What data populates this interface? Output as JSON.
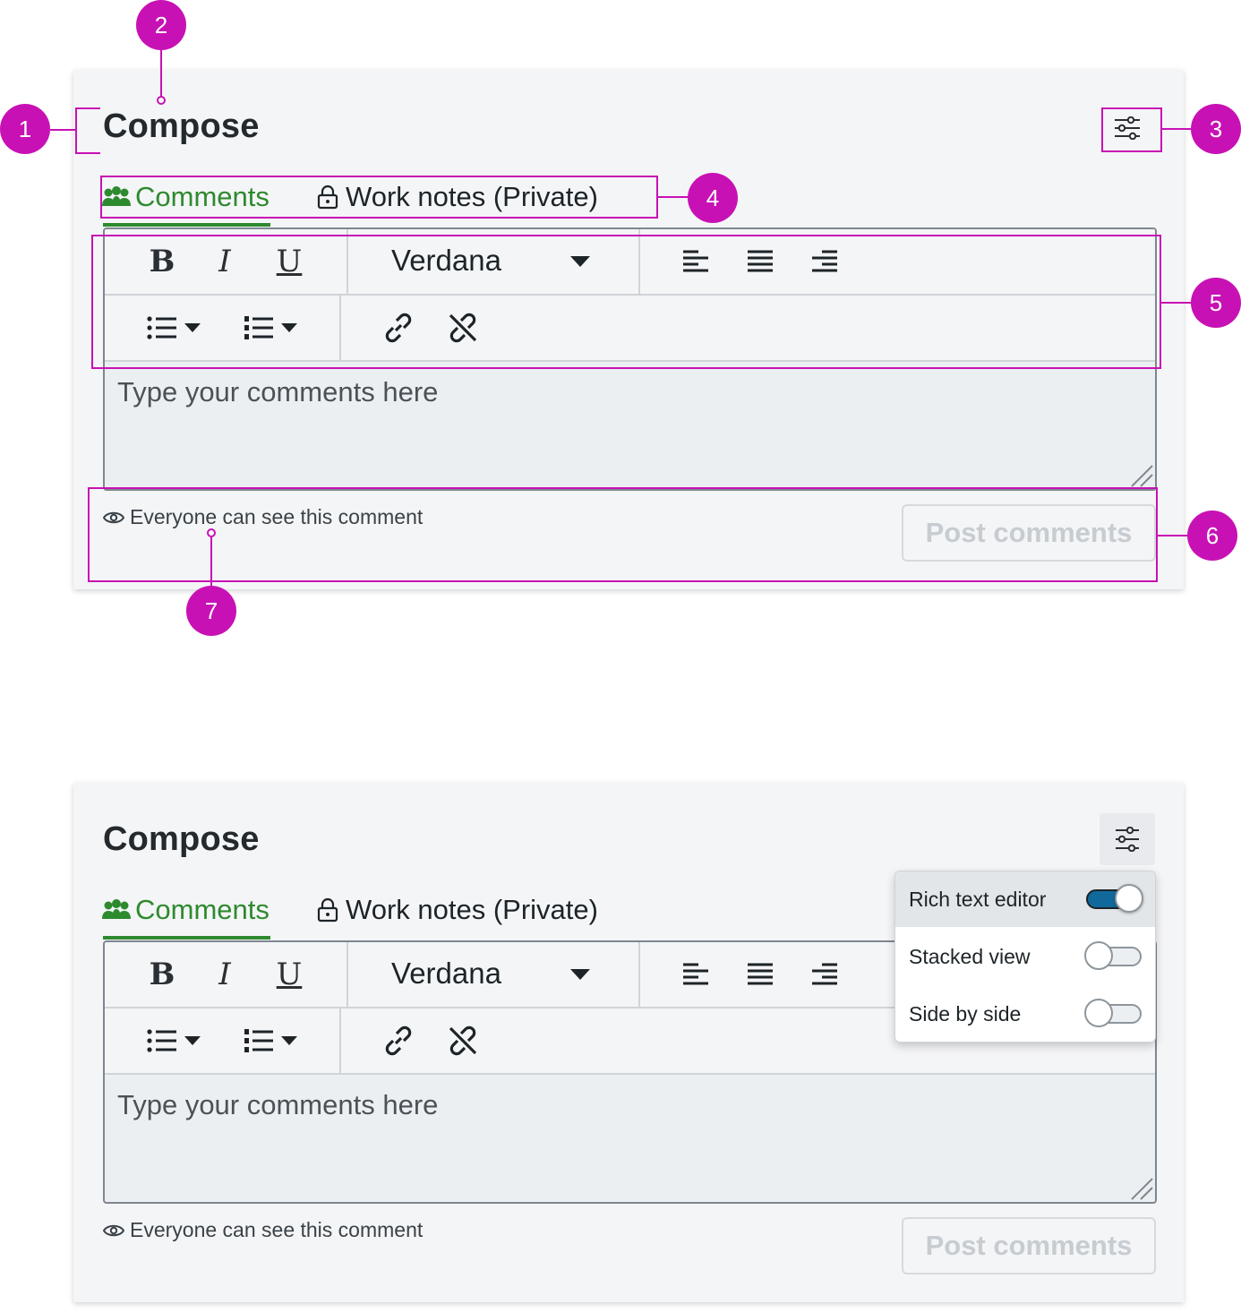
{
  "annotations": [
    "1",
    "2",
    "3",
    "4",
    "5",
    "6",
    "7"
  ],
  "compose": {
    "title": "Compose",
    "tabs": [
      {
        "label": "Comments",
        "icon": "users-icon",
        "active": true
      },
      {
        "label": "Work notes (Private)",
        "icon": "lock-icon",
        "active": false
      }
    ],
    "toolbar": {
      "bold": "B",
      "italic": "I",
      "underline": "U",
      "font": "Verdana"
    },
    "placeholder": "Type your comments here",
    "visibility_text": "Everyone can see this comment",
    "post_label": "Post comments"
  },
  "settings_menu": {
    "items": [
      {
        "label": "Rich text editor",
        "on": true
      },
      {
        "label": "Stacked view",
        "on": false
      },
      {
        "label": "Side by side",
        "on": false
      }
    ]
  },
  "colors": {
    "accent_green": "#2e8a2e",
    "annotation_magenta": "#c811b4",
    "toggle_on": "#11699b"
  }
}
